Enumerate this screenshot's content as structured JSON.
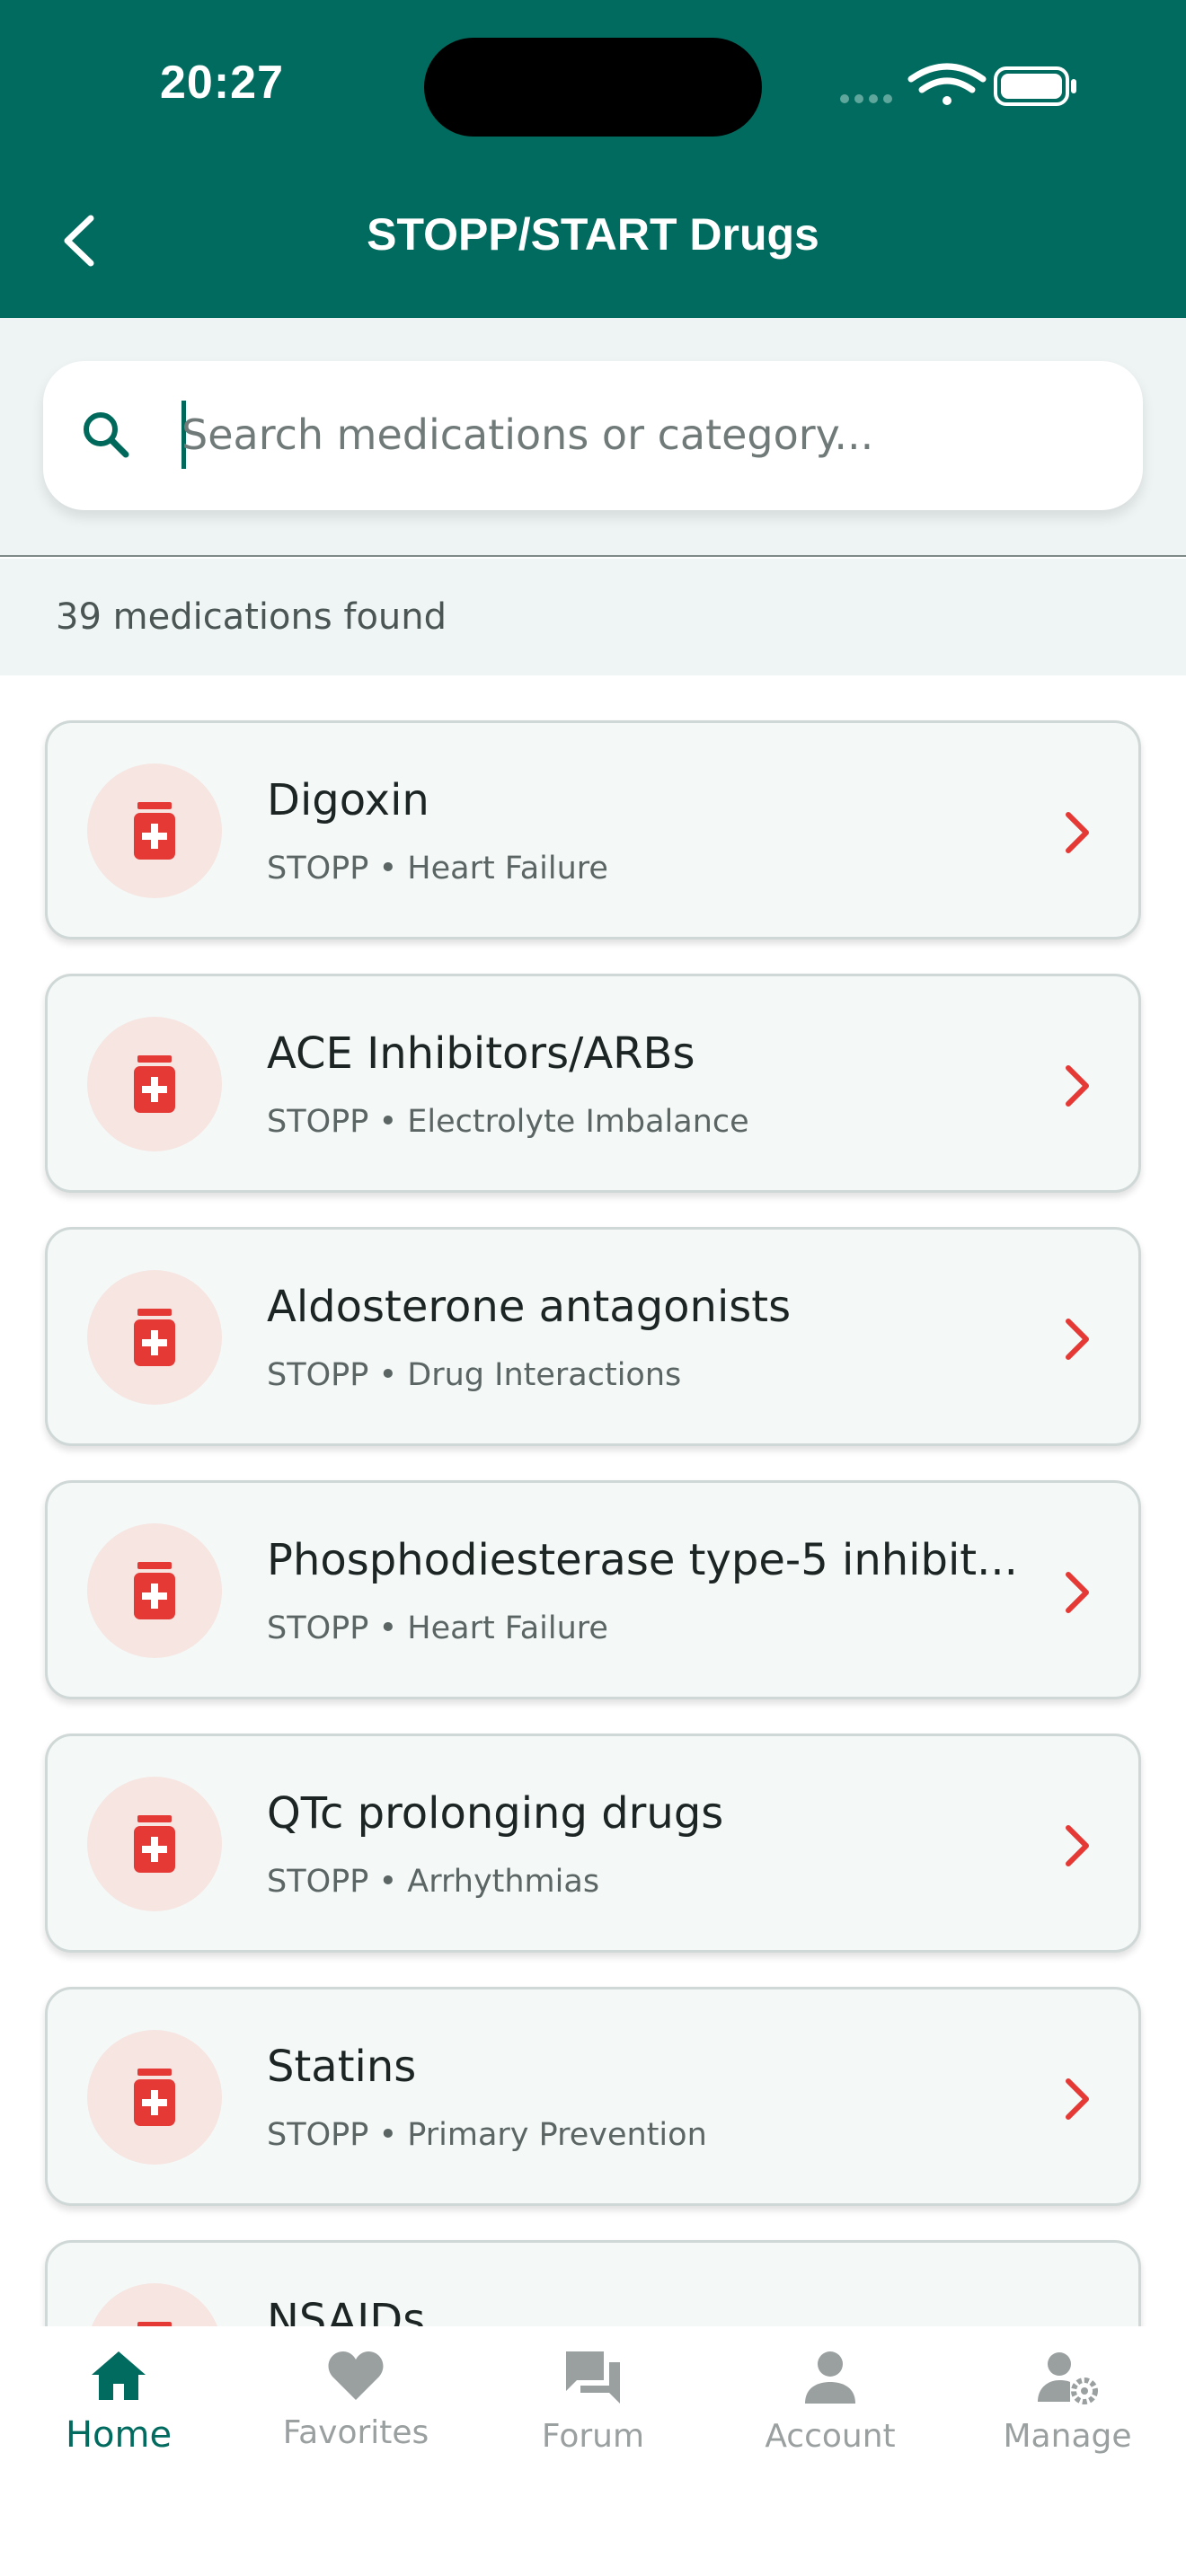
{
  "status_bar": {
    "time": "20:27"
  },
  "header": {
    "title": "STOPP/START Drugs"
  },
  "search": {
    "placeholder": "Search medications or category...",
    "value": ""
  },
  "results": {
    "count_text": "39 medications found"
  },
  "medications": [
    {
      "name": "Digoxin",
      "type": "STOPP",
      "category": "Heart Failure"
    },
    {
      "name": "ACE Inhibitors/ARBs",
      "type": "STOPP",
      "category": "Electrolyte Imbalance"
    },
    {
      "name": "Aldosterone antagonists",
      "type": "STOPP",
      "category": "Drug Interactions"
    },
    {
      "name": "Phosphodiesterase type-5 inhibit...",
      "type": "STOPP",
      "category": "Heart Failure"
    },
    {
      "name": "QTc prolonging drugs",
      "type": "STOPP",
      "category": "Arrhythmias"
    },
    {
      "name": "Statins",
      "type": "STOPP",
      "category": "Primary Prevention"
    },
    {
      "name": "NSAIDs",
      "type": "",
      "category": ""
    }
  ],
  "nav": {
    "items": [
      {
        "label": "Home",
        "icon": "home-icon",
        "active": true
      },
      {
        "label": "Favorites",
        "icon": "heart-icon",
        "active": false
      },
      {
        "label": "Forum",
        "icon": "forum-icon",
        "active": false
      },
      {
        "label": "Account",
        "icon": "account-icon",
        "active": false
      },
      {
        "label": "Manage",
        "icon": "manage-icon",
        "active": false
      }
    ]
  },
  "colors": {
    "primary": "#006b5e",
    "accent_red": "#e53935",
    "icon_bg": "#f6e5e1",
    "inactive": "#9a9fa0"
  }
}
